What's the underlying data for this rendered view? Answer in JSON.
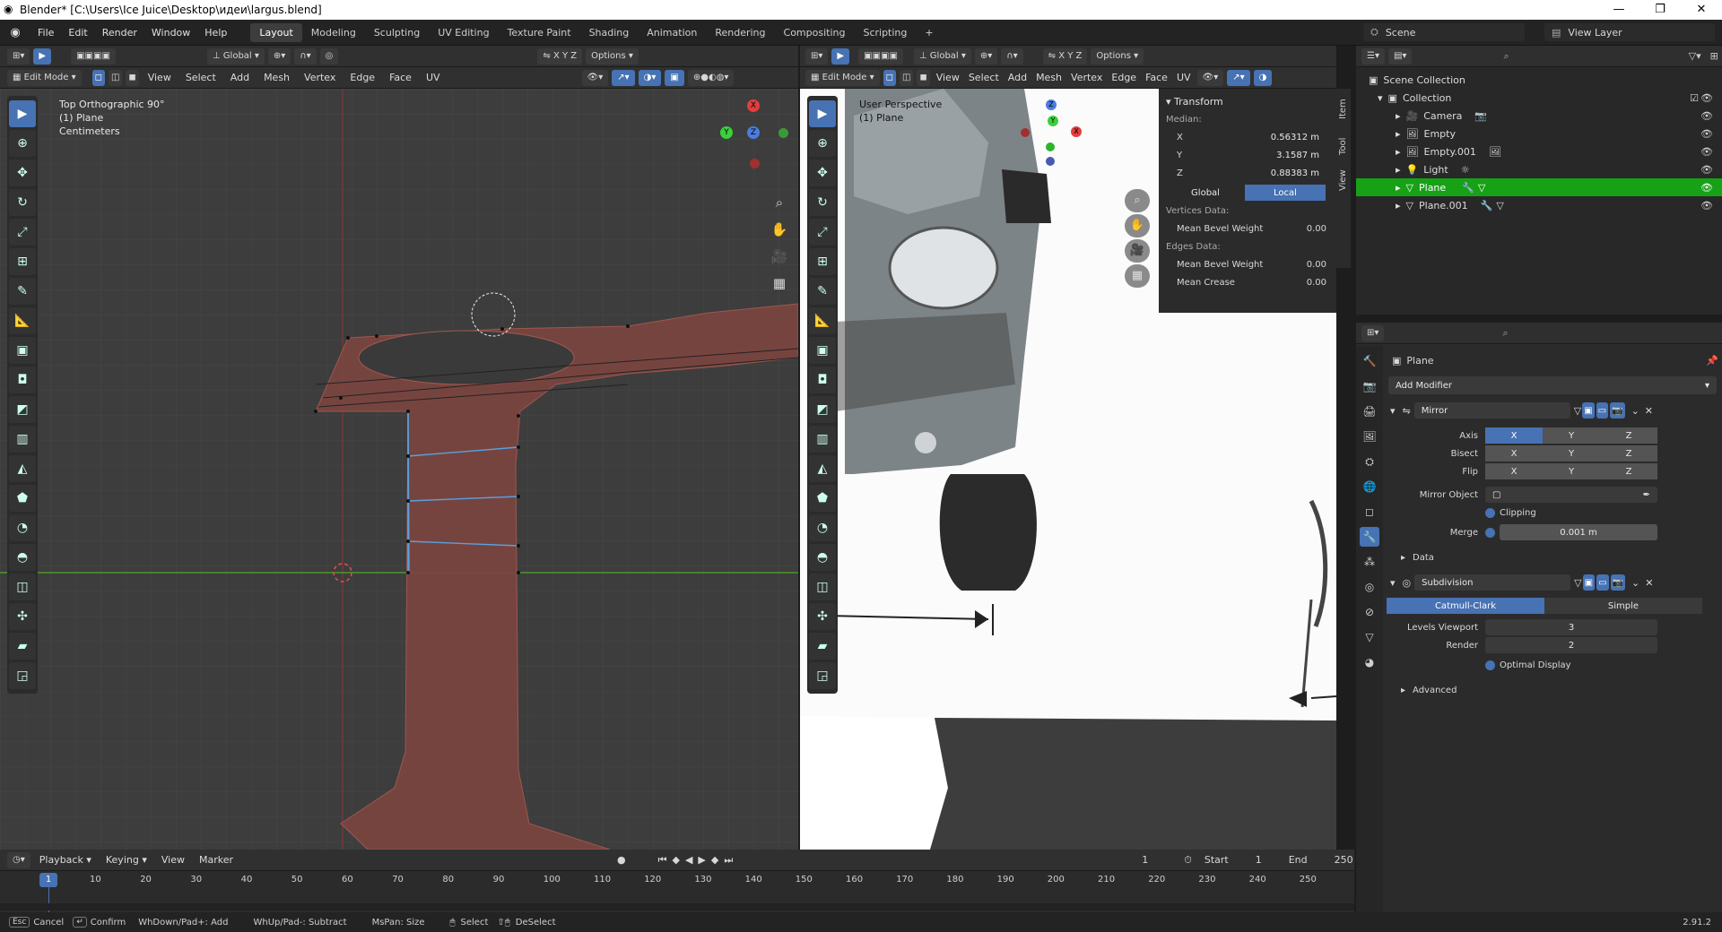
{
  "window": {
    "title": "Blender* [C:\\Users\\Ice Juice\\Desktop\\идеи\\largus.blend]",
    "minimize": "—",
    "maximize": "❐",
    "close": "✕"
  },
  "menu": [
    "File",
    "Edit",
    "Render",
    "Window",
    "Help"
  ],
  "workspaces": [
    "Layout",
    "Modeling",
    "Sculpting",
    "UV Editing",
    "Texture Paint",
    "Shading",
    "Animation",
    "Rendering",
    "Compositing",
    "Scripting",
    "+"
  ],
  "active_workspace": "Layout",
  "scene": {
    "label": "Scene",
    "view_layer": "View Layer"
  },
  "left_vp": {
    "orientation": "Global",
    "options": "Options",
    "mode": "Edit Mode",
    "menus": [
      "View",
      "Select",
      "Add",
      "Mesh",
      "Vertex",
      "Edge",
      "Face",
      "UV"
    ],
    "overlay": [
      "Top Orthographic 90°",
      "(1) Plane",
      "Centimeters"
    ],
    "gizmo": {
      "x": "X",
      "y": "Y",
      "z": "Z"
    }
  },
  "right_vp": {
    "orientation": "Global",
    "options": "Options",
    "mode": "Edit Mode",
    "menus": [
      "View",
      "Select",
      "Add",
      "Mesh",
      "Vertex",
      "Edge",
      "Face",
      "UV"
    ],
    "overlay": [
      "User Perspective",
      "(1) Plane"
    ],
    "gizmo": {
      "x": "X",
      "y": "Y",
      "z": "Z"
    }
  },
  "npanel": {
    "title": "Transform",
    "median": "Median:",
    "x_label": "X",
    "x": "0.56312 m",
    "y_label": "Y",
    "y": "3.1587 m",
    "z_label": "Z",
    "z": "0.88383 m",
    "global": "Global",
    "local": "Local",
    "vertices_data": "Vertices Data:",
    "mean_bevel_v": "Mean Bevel Weight",
    "mean_bevel_v_val": "0.00",
    "edges_data": "Edges Data:",
    "mean_bevel_e": "Mean Bevel Weight",
    "mean_bevel_e_val": "0.00",
    "mean_crease": "Mean Crease",
    "mean_crease_val": "0.00",
    "tabs": [
      "Item",
      "Tool",
      "View"
    ]
  },
  "outliner": {
    "root": "Scene Collection",
    "items": [
      {
        "name": "Collection",
        "indent": 1
      },
      {
        "name": "Camera",
        "indent": 2
      },
      {
        "name": "Empty",
        "indent": 2
      },
      {
        "name": "Empty.001",
        "indent": 2
      },
      {
        "name": "Light",
        "indent": 2
      },
      {
        "name": "Plane",
        "indent": 2
      },
      {
        "name": "Plane.001",
        "indent": 2
      }
    ]
  },
  "properties": {
    "object": "Plane",
    "add_modifier": "Add Modifier",
    "mirror": {
      "name": "Mirror",
      "axis": "Axis",
      "bisect": "Bisect",
      "flip": "Flip",
      "x": "X",
      "y": "Y",
      "z": "Z",
      "mirror_object": "Mirror Object",
      "clipping": "Clipping",
      "merge": "Merge",
      "merge_val": "0.001 m",
      "data": "Data"
    },
    "subdiv": {
      "name": "Subdivision",
      "catmull": "Catmull-Clark",
      "simple": "Simple",
      "levels_viewport": "Levels Viewport",
      "levels_val": "3",
      "render": "Render",
      "render_val": "2",
      "optimal": "Optimal Display",
      "advanced": "Advanced"
    }
  },
  "timeline": {
    "menus": [
      "Playback",
      "Keying",
      "View",
      "Marker"
    ],
    "current": "1",
    "start_label": "Start",
    "start": "1",
    "end_label": "End",
    "end": "250",
    "frame": "1",
    "ticks": [
      "10",
      "20",
      "30",
      "40",
      "50",
      "60",
      "70",
      "80",
      "90",
      "100",
      "110",
      "120",
      "130",
      "140",
      "150",
      "160",
      "170",
      "180",
      "190",
      "200",
      "210",
      "220",
      "230",
      "240",
      "250"
    ]
  },
  "status": {
    "cancel_key": "Esc",
    "cancel": "Cancel",
    "confirm": "Confirm",
    "add": "WhDown/Pad+: Add",
    "subtract": "WhUp/Pad-: Subtract",
    "size": "MsPan: Size",
    "select": "Select",
    "deselect": "DeSelect",
    "version": "2.91.2"
  }
}
